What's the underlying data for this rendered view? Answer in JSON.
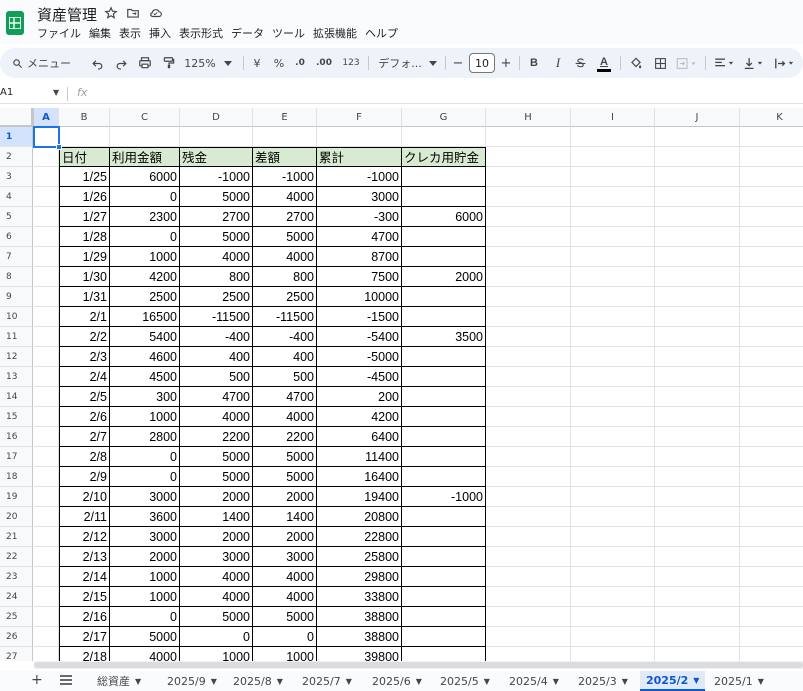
{
  "app": {
    "title": "資産管理",
    "menu": [
      "ファイル",
      "編集",
      "表示",
      "挿入",
      "表示形式",
      "データ",
      "ツール",
      "拡張機能",
      "ヘルプ"
    ]
  },
  "toolbar": {
    "search_label": "メニュー",
    "zoom": "125%",
    "currency": "¥",
    "percent": "%",
    "dec_decrease": ".0",
    "dec_increase": ".00",
    "number_format": "123",
    "font": "デフォ...",
    "minus": "−",
    "font_size": "10",
    "plus": "+",
    "bold": "B",
    "italic": "I",
    "text_color": "A"
  },
  "formula_bar": {
    "name_box": "A1",
    "fx": "fx"
  },
  "columns": [
    "A",
    "B",
    "C",
    "D",
    "E",
    "F",
    "G",
    "H",
    "I",
    "J",
    "K"
  ],
  "rows": [
    "1",
    "2",
    "3",
    "4",
    "5",
    "6",
    "7",
    "8",
    "9",
    "10",
    "11",
    "12",
    "13",
    "14",
    "15",
    "16",
    "17",
    "18",
    "19",
    "20",
    "21",
    "22",
    "23",
    "24",
    "25",
    "26",
    "27"
  ],
  "sheet": {
    "headers": [
      "日付",
      "利用金額",
      "残金",
      "差額",
      "累計",
      "クレカ用貯金"
    ],
    "data": [
      [
        "1/25",
        "6000",
        "-1000",
        "-1000",
        "-1000",
        ""
      ],
      [
        "1/26",
        "0",
        "5000",
        "4000",
        "3000",
        ""
      ],
      [
        "1/27",
        "2300",
        "2700",
        "2700",
        "-300",
        "6000"
      ],
      [
        "1/28",
        "0",
        "5000",
        "5000",
        "4700",
        ""
      ],
      [
        "1/29",
        "1000",
        "4000",
        "4000",
        "8700",
        ""
      ],
      [
        "1/30",
        "4200",
        "800",
        "800",
        "7500",
        "2000"
      ],
      [
        "1/31",
        "2500",
        "2500",
        "2500",
        "10000",
        ""
      ],
      [
        "2/1",
        "16500",
        "-11500",
        "-11500",
        "-1500",
        ""
      ],
      [
        "2/2",
        "5400",
        "-400",
        "-400",
        "-5400",
        "3500"
      ],
      [
        "2/3",
        "4600",
        "400",
        "400",
        "-5000",
        ""
      ],
      [
        "2/4",
        "4500",
        "500",
        "500",
        "-4500",
        ""
      ],
      [
        "2/5",
        "300",
        "4700",
        "4700",
        "200",
        ""
      ],
      [
        "2/6",
        "1000",
        "4000",
        "4000",
        "4200",
        ""
      ],
      [
        "2/7",
        "2800",
        "2200",
        "2200",
        "6400",
        ""
      ],
      [
        "2/8",
        "0",
        "5000",
        "5000",
        "11400",
        ""
      ],
      [
        "2/9",
        "0",
        "5000",
        "5000",
        "16400",
        ""
      ],
      [
        "2/10",
        "3000",
        "2000",
        "2000",
        "19400",
        "-1000"
      ],
      [
        "2/11",
        "3600",
        "1400",
        "1400",
        "20800",
        ""
      ],
      [
        "2/12",
        "3000",
        "2000",
        "2000",
        "22800",
        ""
      ],
      [
        "2/13",
        "2000",
        "3000",
        "3000",
        "25800",
        ""
      ],
      [
        "2/14",
        "1000",
        "4000",
        "4000",
        "29800",
        ""
      ],
      [
        "2/15",
        "1000",
        "4000",
        "4000",
        "33800",
        ""
      ],
      [
        "2/16",
        "0",
        "5000",
        "5000",
        "38800",
        ""
      ],
      [
        "2/17",
        "5000",
        "0",
        "0",
        "38800",
        ""
      ],
      [
        "2/18",
        "4000",
        "1000",
        "1000",
        "39800",
        ""
      ]
    ]
  },
  "tabs": {
    "add": "+",
    "items": [
      "総資産",
      "2025/9",
      "2025/8",
      "2025/7",
      "2025/6",
      "2025/5",
      "2025/4",
      "2025/3",
      "2025/2",
      "2025/1"
    ],
    "active": "2025/2"
  },
  "colors": {
    "header_fill": "#d9ead3",
    "selection": "#1a73e8",
    "active_tab": "#0b57d0",
    "logo": "#0f9d58"
  }
}
